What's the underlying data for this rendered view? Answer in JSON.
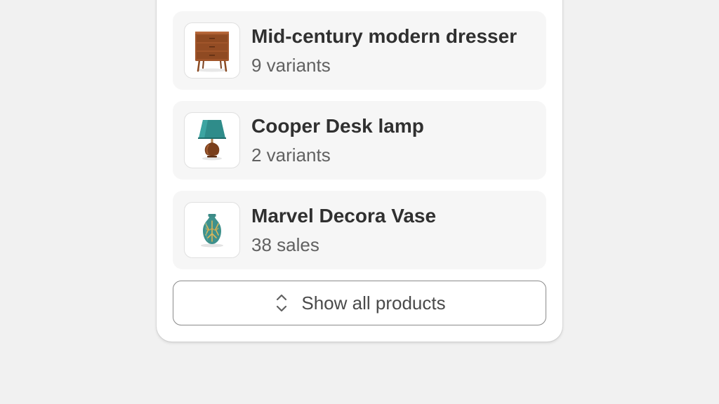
{
  "products": [
    {
      "title": "Mid-century modern dresser",
      "subtitle": "9 variants",
      "icon": "dresser-image"
    },
    {
      "title": "Cooper Desk lamp",
      "subtitle": "2 variants",
      "icon": "lamp-image"
    },
    {
      "title": "Marvel Decora Vase",
      "subtitle": "38 sales",
      "icon": "vase-image"
    }
  ],
  "show_all": {
    "label": "Show all products",
    "icon": "chevron-up-down-icon"
  },
  "colors": {
    "page_background": "#f1f1f1",
    "card_background": "#ffffff",
    "row_background": "#f6f6f6",
    "title_text": "#303030",
    "subtitle_text": "#616161"
  }
}
